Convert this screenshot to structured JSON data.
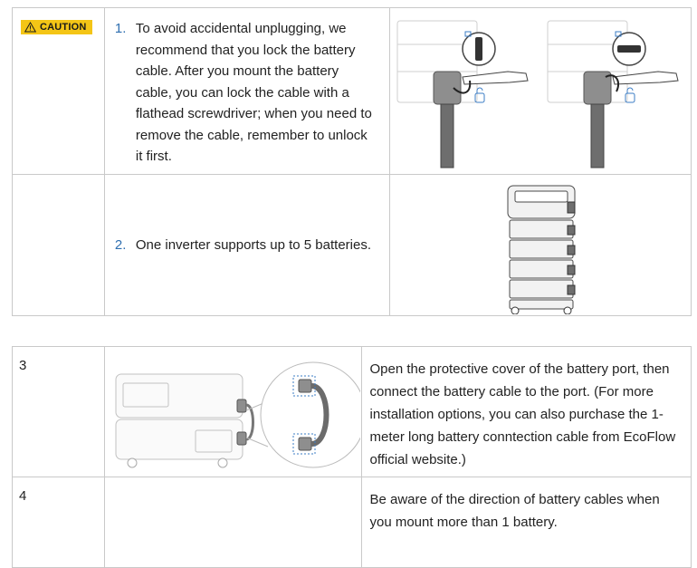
{
  "caution": {
    "label": "CAUTION",
    "icon": "warning-triangle-icon",
    "color": "#f4c516"
  },
  "rows_top": [
    {
      "number": "1.",
      "text": "To avoid accidental unplugging, we recommend that you lock the battery cable. After you mount the battery cable, you can lock the cable with a flathead screwdriver; when you need to remove the cable, remember to unlock it first.",
      "image": "lock-battery-cable-illustration"
    },
    {
      "number": "2.",
      "text": "One inverter supports up to 5 batteries.",
      "image": "battery-stack-illustration"
    }
  ],
  "rows_bottom": [
    {
      "number": "3",
      "text": "Open the protective cover of the battery port, then connect the battery cable to the port. (For more installation options, you can also purchase the 1-meter long battery conntection cable from EcoFlow official website.)",
      "image": "battery-port-connection-illustration"
    },
    {
      "number": "4",
      "text": "Be aware of the direction of battery cables when you mount more than 1 battery."
    }
  ],
  "colors": {
    "number_blue": "#2f6fb0",
    "accent_blue": "#3b7cc4",
    "border": "#c9c9c9"
  }
}
